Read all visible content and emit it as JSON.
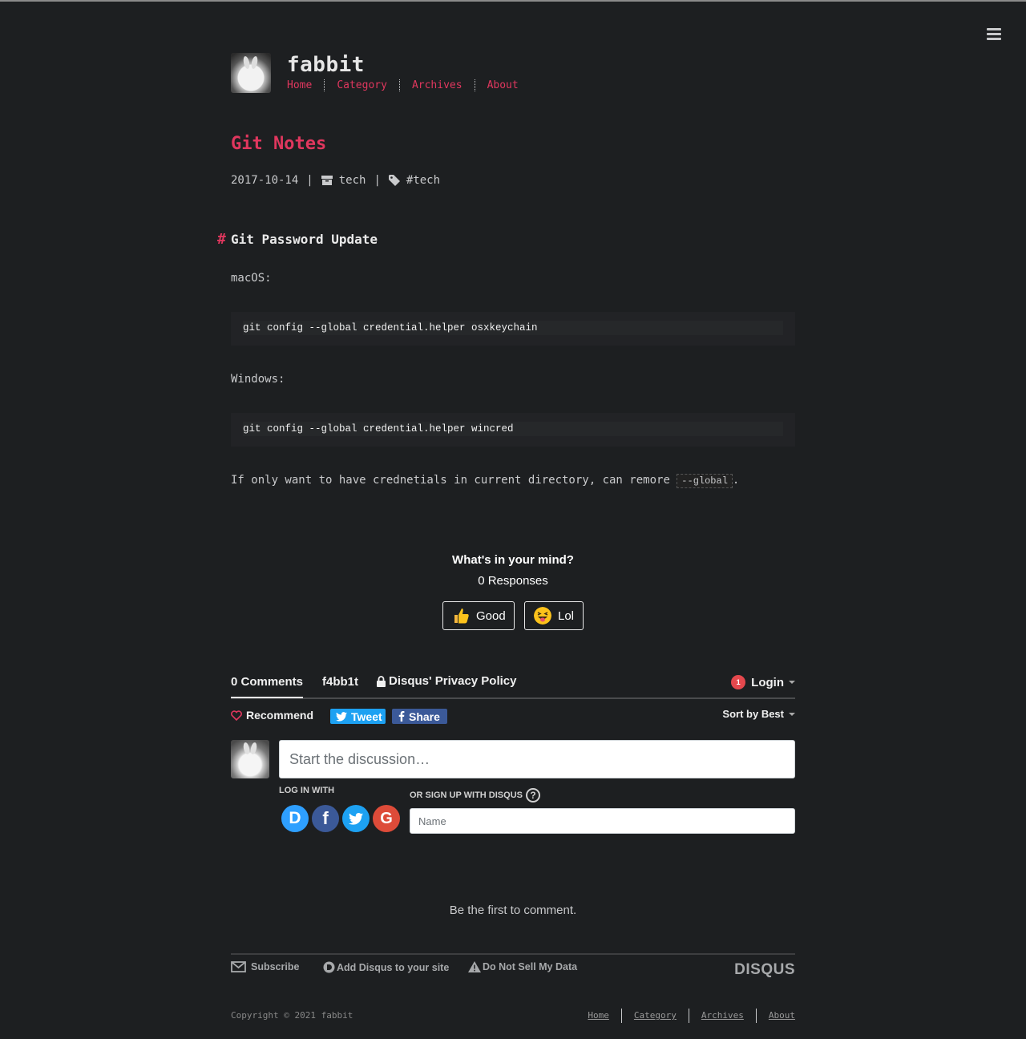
{
  "site": {
    "title": "fabbit",
    "nav": [
      "Home",
      "Category",
      "Archives",
      "About"
    ]
  },
  "post": {
    "title": "Git Notes",
    "date": "2017-10-14",
    "category": "tech",
    "tag": "#tech",
    "heading_hash": "#",
    "heading": "Git Password Update",
    "p_macos": "macOS:",
    "code_macos": "git config --global credential.helper osxkeychain",
    "p_windows": "Windows:",
    "code_windows": "git config --global credential.helper wincred",
    "p_note_before": "If only want to have crednetials in current directory, can remore ",
    "p_note_code": "--global",
    "p_note_after": "."
  },
  "reactions": {
    "title": "What's in your mind?",
    "count": "0 Responses",
    "good": "Good",
    "lol": "Lol"
  },
  "disqus": {
    "tab_comments": "0 Comments",
    "tab_site": "f4bb1t",
    "tab_privacy": "Disqus' Privacy Policy",
    "login_badge": "1",
    "login": "Login",
    "recommend": "Recommend",
    "tweet": "Tweet",
    "share": "Share",
    "sort": "Sort by Best",
    "composer_placeholder": "Start the discussion…",
    "log_in_with": "LOG IN WITH",
    "signup_label": "OR SIGN UP WITH DISQUS",
    "signup_help": "?",
    "name_placeholder": "Name",
    "social": {
      "d": "D",
      "f": "f",
      "g": "G"
    },
    "first_comment": "Be the first to comment.",
    "footer_subscribe": "Subscribe",
    "footer_add": "Add Disqus to your site",
    "footer_dns": "Do Not Sell My Data",
    "logo": "DISQUS"
  },
  "footer": {
    "copyright": "Copyright © 2021 fabbit",
    "nav": [
      "Home",
      "Category",
      "Archives",
      "About"
    ]
  },
  "colors": {
    "accent": "#e0375e",
    "background": "#1d1f21",
    "twitter": "#1da1f2",
    "facebook": "#3b5998",
    "google": "#dd4b39",
    "disqus": "#2e9fff"
  }
}
